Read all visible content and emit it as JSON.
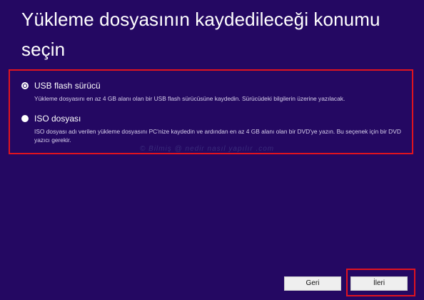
{
  "page": {
    "title": "Yükleme dosyasının kaydedileceği konumu seçin"
  },
  "options": [
    {
      "label": "USB flash sürücü",
      "description": "Yükleme dosyasını en az 4 GB alanı olan bir USB flash sürücüsüne kaydedin. Sürücüdeki bilgilerin üzerine yazılacak.",
      "selected": true
    },
    {
      "label": "ISO dosyası",
      "description": "ISO dosyası adı verilen yükleme dosyasını PC'nize kaydedin ve ardından en az 4 GB alanı olan bir DVD'ye yazın. Bu seçenek için bir DVD yazıcı gerekir.",
      "selected": false
    }
  ],
  "watermark": "© Bilmiş @ nedir nasıl yapılır .com",
  "buttons": {
    "back_label": "Geri",
    "next_label": "İleri"
  },
  "colors": {
    "background": "#240862",
    "highlight": "#e0131f",
    "button": "#efefef"
  }
}
